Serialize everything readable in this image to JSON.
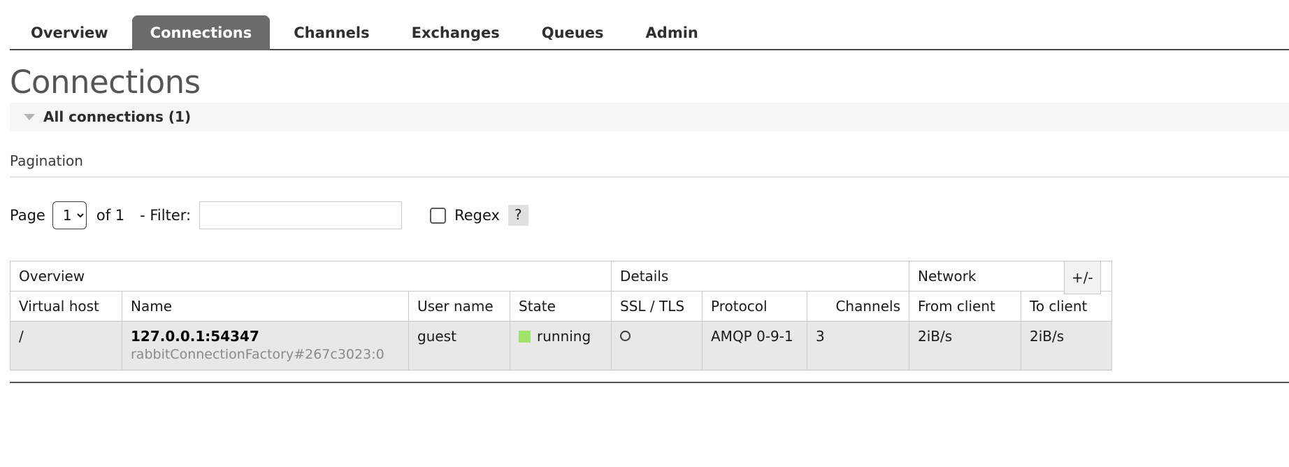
{
  "nav": {
    "tabs": [
      {
        "label": "Overview",
        "active": false
      },
      {
        "label": "Connections",
        "active": true
      },
      {
        "label": "Channels",
        "active": false
      },
      {
        "label": "Exchanges",
        "active": false
      },
      {
        "label": "Queues",
        "active": false
      },
      {
        "label": "Admin",
        "active": false
      }
    ]
  },
  "page": {
    "title": "Connections",
    "section_label": "All connections (1)",
    "toggle_icon": "triangle-down-icon"
  },
  "pagination": {
    "title": "Pagination",
    "page_label": "Page",
    "page_value": "1",
    "page_options": [
      "1"
    ],
    "of_text": "of 1",
    "filter_label": "- Filter:",
    "filter_value": "",
    "filter_placeholder": "",
    "regex_label": "Regex",
    "regex_checked": false,
    "help_label": "?"
  },
  "table": {
    "groups": [
      {
        "label": "Overview",
        "span": 4
      },
      {
        "label": "Details",
        "span": 3
      },
      {
        "label": "Network",
        "span": 2
      }
    ],
    "columns": [
      {
        "label": "Virtual host",
        "align": "left"
      },
      {
        "label": "Name",
        "align": "left"
      },
      {
        "label": "User name",
        "align": "left"
      },
      {
        "label": "State",
        "align": "left"
      },
      {
        "label": "SSL / TLS",
        "align": "left"
      },
      {
        "label": "Protocol",
        "align": "left"
      },
      {
        "label": "Channels",
        "align": "right"
      },
      {
        "label": "From client",
        "align": "left"
      },
      {
        "label": "To client",
        "align": "left"
      }
    ],
    "rows": [
      {
        "vhost": "/",
        "name": "127.0.0.1:54347",
        "name_sub": "rabbitConnectionFactory#267c3023:0",
        "user_name": "guest",
        "state": "running",
        "state_color": "#a0e36a",
        "ssl_tls": "circle-outline-icon",
        "protocol": "AMQP 0-9-1",
        "channels": "3",
        "from_client": "2iB/s",
        "to_client": "2iB/s"
      }
    ],
    "column_toggle": "+/-"
  }
}
